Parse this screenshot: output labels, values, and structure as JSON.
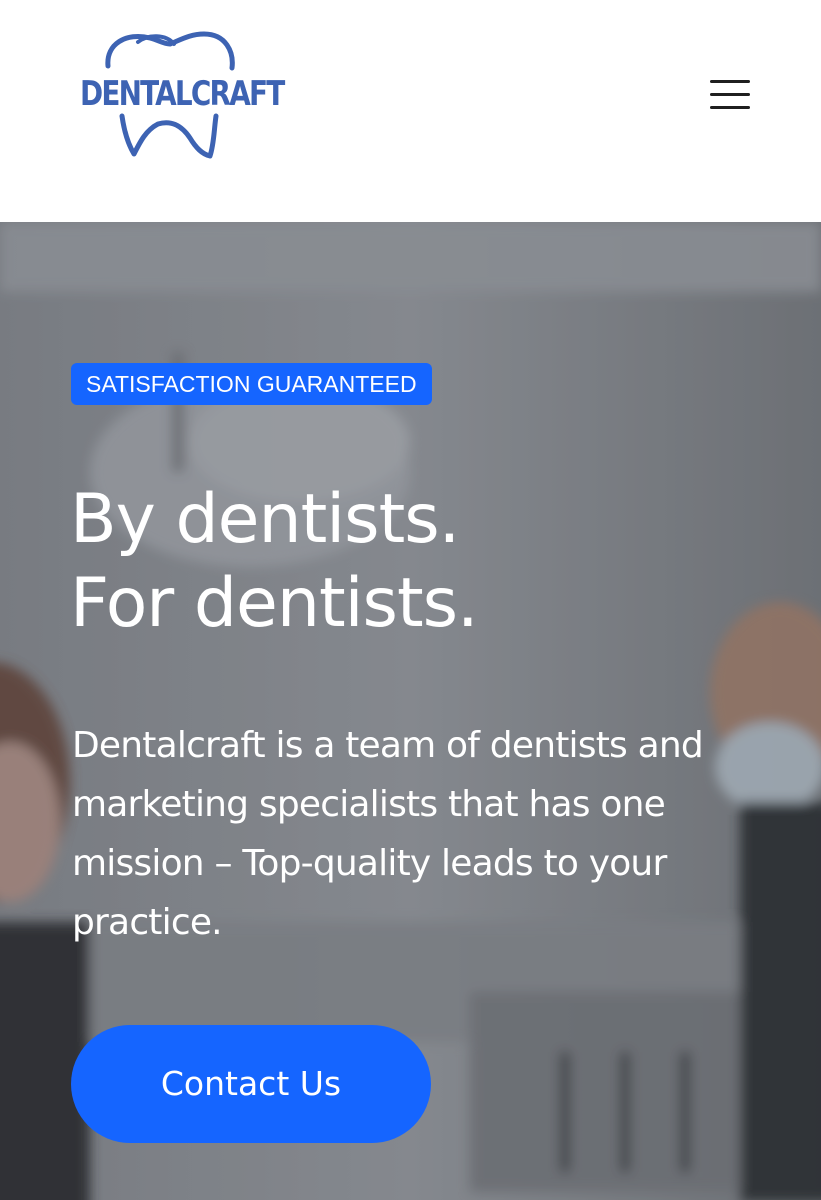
{
  "header": {
    "logo_text": "DENTALCRAFT",
    "logo_icon": "tooth-outline-icon",
    "menu_icon": "hamburger-menu-icon"
  },
  "hero": {
    "badge": "SATISFACTION GUARANTEED",
    "headline_line1": "By dentists.",
    "headline_line2": "For dentists.",
    "description": "Dentalcraft is a team of dentists and marketing specialists that has one mission – Top-quality leads to your practice.",
    "cta_label": "Contact Us"
  },
  "colors": {
    "brand_blue": "#1565ff",
    "logo_blue": "#3d63b3",
    "header_bg": "#ffffff",
    "text_on_hero": "#ffffff"
  }
}
